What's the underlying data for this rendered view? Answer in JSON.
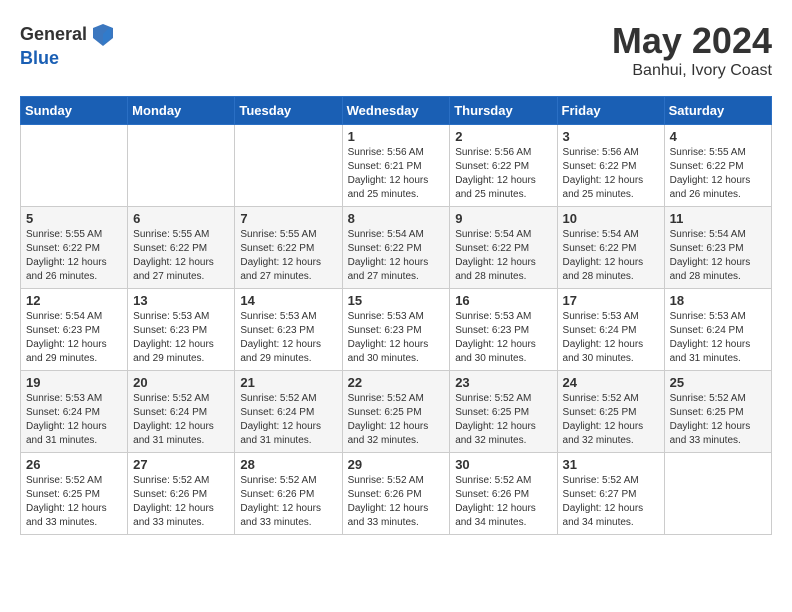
{
  "header": {
    "logo_general": "General",
    "logo_blue": "Blue",
    "month_year": "May 2024",
    "location": "Banhui, Ivory Coast"
  },
  "weekdays": [
    "Sunday",
    "Monday",
    "Tuesday",
    "Wednesday",
    "Thursday",
    "Friday",
    "Saturday"
  ],
  "weeks": [
    [
      {
        "day": "",
        "info": ""
      },
      {
        "day": "",
        "info": ""
      },
      {
        "day": "",
        "info": ""
      },
      {
        "day": "1",
        "info": "Sunrise: 5:56 AM\nSunset: 6:21 PM\nDaylight: 12 hours\nand 25 minutes."
      },
      {
        "day": "2",
        "info": "Sunrise: 5:56 AM\nSunset: 6:22 PM\nDaylight: 12 hours\nand 25 minutes."
      },
      {
        "day": "3",
        "info": "Sunrise: 5:56 AM\nSunset: 6:22 PM\nDaylight: 12 hours\nand 25 minutes."
      },
      {
        "day": "4",
        "info": "Sunrise: 5:55 AM\nSunset: 6:22 PM\nDaylight: 12 hours\nand 26 minutes."
      }
    ],
    [
      {
        "day": "5",
        "info": "Sunrise: 5:55 AM\nSunset: 6:22 PM\nDaylight: 12 hours\nand 26 minutes."
      },
      {
        "day": "6",
        "info": "Sunrise: 5:55 AM\nSunset: 6:22 PM\nDaylight: 12 hours\nand 27 minutes."
      },
      {
        "day": "7",
        "info": "Sunrise: 5:55 AM\nSunset: 6:22 PM\nDaylight: 12 hours\nand 27 minutes."
      },
      {
        "day": "8",
        "info": "Sunrise: 5:54 AM\nSunset: 6:22 PM\nDaylight: 12 hours\nand 27 minutes."
      },
      {
        "day": "9",
        "info": "Sunrise: 5:54 AM\nSunset: 6:22 PM\nDaylight: 12 hours\nand 28 minutes."
      },
      {
        "day": "10",
        "info": "Sunrise: 5:54 AM\nSunset: 6:22 PM\nDaylight: 12 hours\nand 28 minutes."
      },
      {
        "day": "11",
        "info": "Sunrise: 5:54 AM\nSunset: 6:23 PM\nDaylight: 12 hours\nand 28 minutes."
      }
    ],
    [
      {
        "day": "12",
        "info": "Sunrise: 5:54 AM\nSunset: 6:23 PM\nDaylight: 12 hours\nand 29 minutes."
      },
      {
        "day": "13",
        "info": "Sunrise: 5:53 AM\nSunset: 6:23 PM\nDaylight: 12 hours\nand 29 minutes."
      },
      {
        "day": "14",
        "info": "Sunrise: 5:53 AM\nSunset: 6:23 PM\nDaylight: 12 hours\nand 29 minutes."
      },
      {
        "day": "15",
        "info": "Sunrise: 5:53 AM\nSunset: 6:23 PM\nDaylight: 12 hours\nand 30 minutes."
      },
      {
        "day": "16",
        "info": "Sunrise: 5:53 AM\nSunset: 6:23 PM\nDaylight: 12 hours\nand 30 minutes."
      },
      {
        "day": "17",
        "info": "Sunrise: 5:53 AM\nSunset: 6:24 PM\nDaylight: 12 hours\nand 30 minutes."
      },
      {
        "day": "18",
        "info": "Sunrise: 5:53 AM\nSunset: 6:24 PM\nDaylight: 12 hours\nand 31 minutes."
      }
    ],
    [
      {
        "day": "19",
        "info": "Sunrise: 5:53 AM\nSunset: 6:24 PM\nDaylight: 12 hours\nand 31 minutes."
      },
      {
        "day": "20",
        "info": "Sunrise: 5:52 AM\nSunset: 6:24 PM\nDaylight: 12 hours\nand 31 minutes."
      },
      {
        "day": "21",
        "info": "Sunrise: 5:52 AM\nSunset: 6:24 PM\nDaylight: 12 hours\nand 31 minutes."
      },
      {
        "day": "22",
        "info": "Sunrise: 5:52 AM\nSunset: 6:25 PM\nDaylight: 12 hours\nand 32 minutes."
      },
      {
        "day": "23",
        "info": "Sunrise: 5:52 AM\nSunset: 6:25 PM\nDaylight: 12 hours\nand 32 minutes."
      },
      {
        "day": "24",
        "info": "Sunrise: 5:52 AM\nSunset: 6:25 PM\nDaylight: 12 hours\nand 32 minutes."
      },
      {
        "day": "25",
        "info": "Sunrise: 5:52 AM\nSunset: 6:25 PM\nDaylight: 12 hours\nand 33 minutes."
      }
    ],
    [
      {
        "day": "26",
        "info": "Sunrise: 5:52 AM\nSunset: 6:25 PM\nDaylight: 12 hours\nand 33 minutes."
      },
      {
        "day": "27",
        "info": "Sunrise: 5:52 AM\nSunset: 6:26 PM\nDaylight: 12 hours\nand 33 minutes."
      },
      {
        "day": "28",
        "info": "Sunrise: 5:52 AM\nSunset: 6:26 PM\nDaylight: 12 hours\nand 33 minutes."
      },
      {
        "day": "29",
        "info": "Sunrise: 5:52 AM\nSunset: 6:26 PM\nDaylight: 12 hours\nand 33 minutes."
      },
      {
        "day": "30",
        "info": "Sunrise: 5:52 AM\nSunset: 6:26 PM\nDaylight: 12 hours\nand 34 minutes."
      },
      {
        "day": "31",
        "info": "Sunrise: 5:52 AM\nSunset: 6:27 PM\nDaylight: 12 hours\nand 34 minutes."
      },
      {
        "day": "",
        "info": ""
      }
    ]
  ]
}
